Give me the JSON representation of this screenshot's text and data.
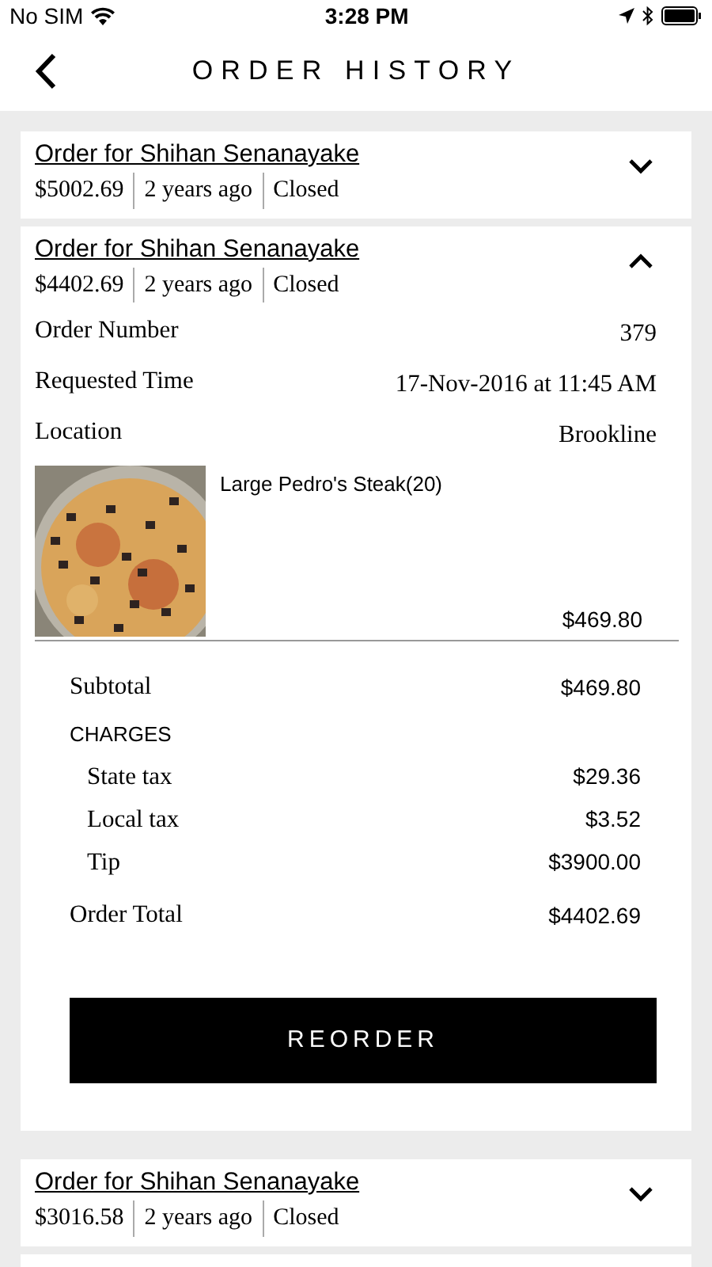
{
  "status_bar": {
    "carrier": "No SIM",
    "time": "3:28 PM"
  },
  "header": {
    "title": "ORDER HISTORY"
  },
  "orders": [
    {
      "title": "Order for Shihan Senanayake",
      "total": "$5002.69",
      "age": "2 years ago",
      "status": "Closed",
      "expanded": false
    },
    {
      "title": "Order for Shihan Senanayake",
      "total": "$4402.69",
      "age": "2 years ago",
      "status": "Closed",
      "expanded": true,
      "details": {
        "fields": [
          {
            "label": "Order Number",
            "value": "379"
          },
          {
            "label": "Requested Time",
            "value": "17-Nov-2016 at 11:45 AM"
          },
          {
            "label": "Location",
            "value": "Brookline"
          }
        ],
        "items": [
          {
            "name": "Large Pedro's Steak(20)",
            "price": "$469.80"
          }
        ],
        "summary": [
          {
            "kind": "line",
            "label": "Subtotal",
            "value": "$469.80"
          },
          {
            "kind": "heading",
            "label": "CHARGES"
          },
          {
            "kind": "sub",
            "label": "State tax",
            "value": "$29.36"
          },
          {
            "kind": "sub",
            "label": "Local tax",
            "value": "$3.52"
          },
          {
            "kind": "sub",
            "label": "Tip",
            "value": "$3900.00"
          },
          {
            "kind": "total",
            "label": "Order Total",
            "value": "$4402.69"
          }
        ],
        "button": "REORDER"
      }
    },
    {
      "title": "Order for Shihan Senanayake",
      "total": "$3016.58",
      "age": "2 years ago",
      "status": "Closed",
      "expanded": false
    }
  ]
}
